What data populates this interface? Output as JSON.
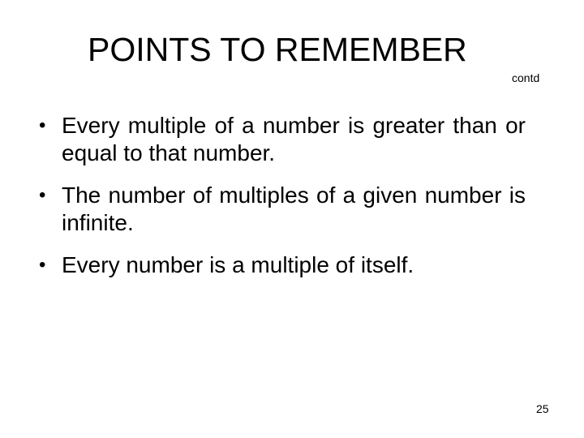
{
  "slide": {
    "title": "POINTS TO REMEMBER",
    "subtitle_note": "contd",
    "bullet_glyph": "•",
    "bullets": [
      "Every multiple of a number is greater than or equal to that number.",
      "The number of multiples of a given number is infinite.",
      "Every number is a multiple of itself."
    ],
    "page_number": "25"
  }
}
